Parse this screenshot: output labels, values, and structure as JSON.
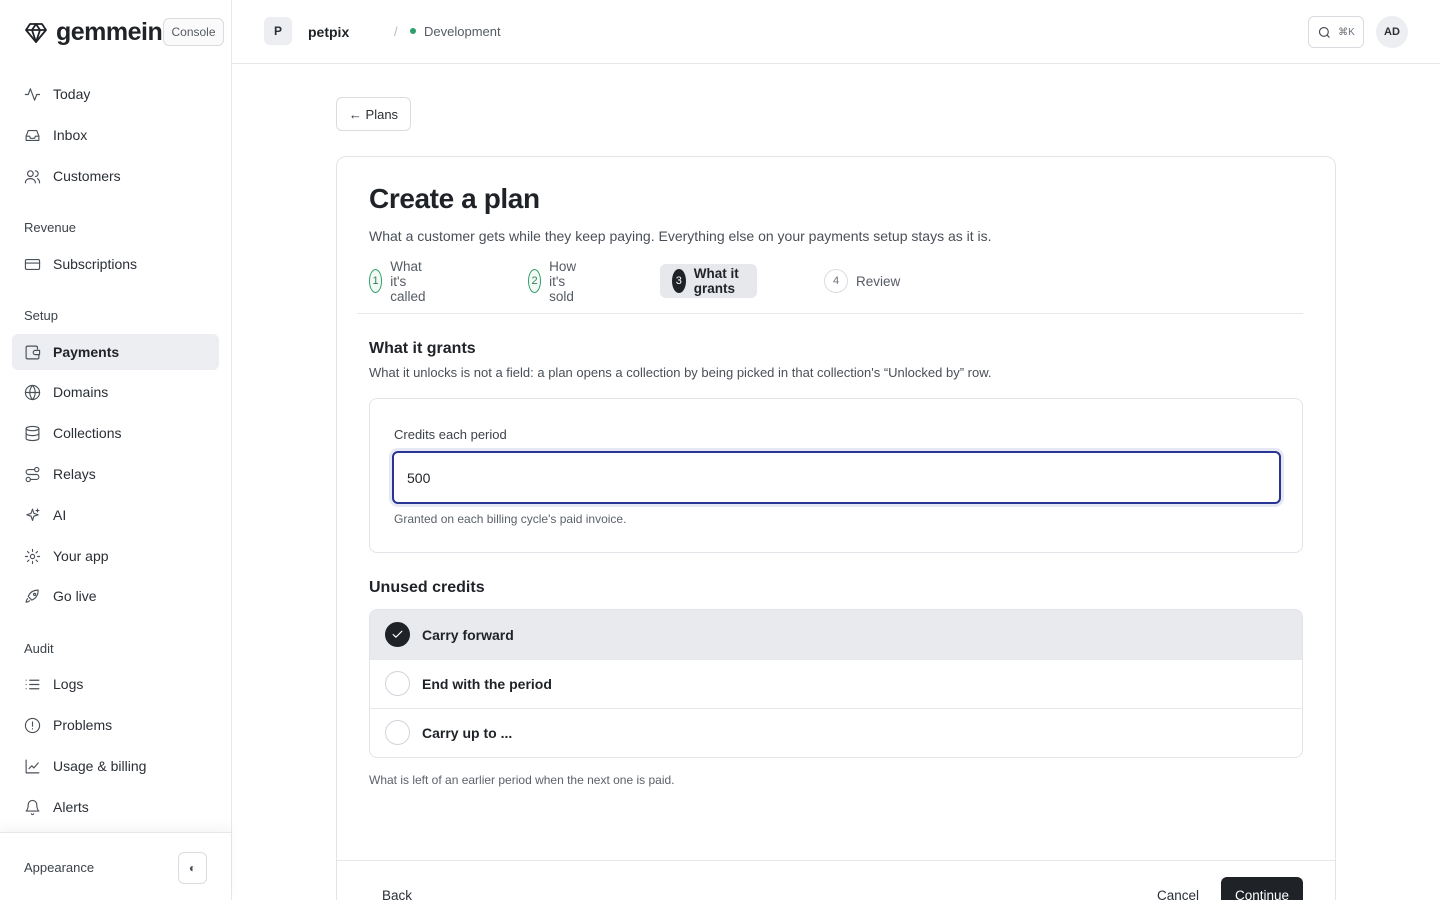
{
  "brand": {
    "name": "gemmein",
    "badge": "Console"
  },
  "sidebar": {
    "primary": [
      {
        "label": "Today",
        "icon": "activity-icon"
      },
      {
        "label": "Inbox",
        "icon": "inbox-icon"
      },
      {
        "label": "Customers",
        "icon": "users-icon"
      }
    ],
    "sections": {
      "revenue": "Revenue",
      "setup": "Setup",
      "audit": "Audit"
    },
    "revenue_items": [
      {
        "label": "Subscriptions",
        "icon": "credit-card-icon"
      }
    ],
    "setup_items": [
      {
        "label": "Payments",
        "icon": "wallet-icon",
        "active": true
      },
      {
        "label": "Domains",
        "icon": "globe-icon"
      },
      {
        "label": "Collections",
        "icon": "database-icon"
      },
      {
        "label": "Relays",
        "icon": "route-icon"
      },
      {
        "label": "AI",
        "icon": "sparkles-icon"
      },
      {
        "label": "Your app",
        "icon": "gear-icon"
      },
      {
        "label": "Go live",
        "icon": "rocket-icon"
      }
    ],
    "audit_items": [
      {
        "label": "Logs",
        "icon": "list-icon"
      },
      {
        "label": "Problems",
        "icon": "alert-circle-icon"
      },
      {
        "label": "Usage & billing",
        "icon": "chart-icon"
      },
      {
        "label": "Alerts",
        "icon": "bell-icon"
      }
    ],
    "appearance": {
      "label": "Appearance",
      "toggle_glyph": "◐"
    }
  },
  "topbar": {
    "project_initial": "P",
    "project_name": "petpix",
    "separator": "/",
    "environment": "Development",
    "search_shortcut": "⌘K",
    "user_initials": "AD"
  },
  "main": {
    "back_label": "← Plans",
    "title": "Create a plan",
    "subtitle": "What a customer gets while they keep paying. Everything else on your payments setup stays as it is.",
    "steps": [
      {
        "num": "1",
        "label": "What it's called",
        "state": "done"
      },
      {
        "num": "2",
        "label": "How it's sold",
        "state": "done"
      },
      {
        "num": "3",
        "label": "What it grants",
        "state": "current"
      },
      {
        "num": "4",
        "label": "Review",
        "state": "todo"
      }
    ],
    "grants": {
      "title": "What it grants",
      "description": "What it unlocks is not a field: a plan opens a collection by being picked in that collection's “Unlocked by” row.",
      "field_label": "Credits each period",
      "field_value": "500",
      "field_hint": "Granted on each billing cycle's paid invoice."
    },
    "unused": {
      "title": "Unused credits",
      "options": [
        {
          "label": "Carry forward",
          "selected": true
        },
        {
          "label": "End with the period",
          "selected": false
        },
        {
          "label": "Carry up to ...",
          "selected": false
        }
      ],
      "hint": "What is left of an earlier period when the next one is paid."
    },
    "footer": {
      "back": "Back",
      "cancel": "Cancel",
      "continue": "Continue"
    }
  },
  "colors": {
    "accent": "#283593",
    "success": "#2f9e6a",
    "primary_button": "#1f2328"
  }
}
